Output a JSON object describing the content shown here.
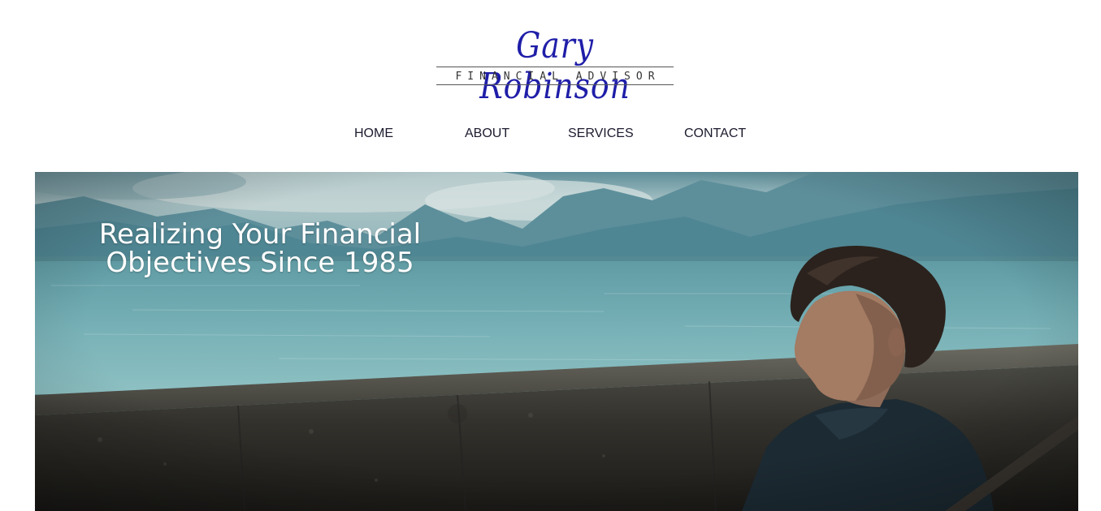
{
  "logo": {
    "name": "Gary Robinson",
    "tagline": "FINANCIAL ADVISOR"
  },
  "nav": {
    "items": [
      {
        "label": "HOME"
      },
      {
        "label": "ABOUT"
      },
      {
        "label": "SERVICES"
      },
      {
        "label": "CONTACT"
      }
    ]
  },
  "hero": {
    "headline_line1": "Realizing Your Financial",
    "headline_line2": "Objectives Since 1985",
    "image": "man-sitting-by-lake-photo"
  },
  "colors": {
    "brand": "#1f1ea8",
    "nav_text": "#1b1b2e",
    "headline": "#ffffff"
  }
}
